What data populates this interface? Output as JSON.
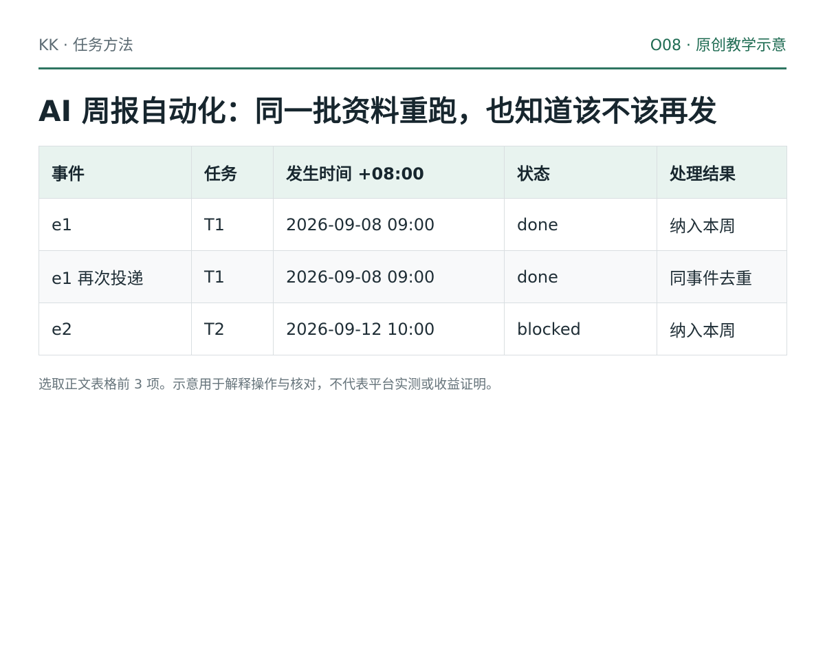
{
  "header": {
    "left_label": "KK · 任务方法",
    "right_label": "O08 · 原创教学示意"
  },
  "title": "AI 周报自动化：同一批资料重跑，也知道该不该再发",
  "table": {
    "columns": [
      "事件",
      "任务",
      "发生时间 +08:00",
      "状态",
      "处理结果"
    ],
    "rows": [
      [
        "e1",
        "T1",
        "2026-09-08 09:00",
        "done",
        "纳入本周"
      ],
      [
        "e1 再次投递",
        "T1",
        "2026-09-08 09:00",
        "done",
        "同事件去重"
      ],
      [
        "e2",
        "T2",
        "2026-09-12 10:00",
        "blocked",
        "纳入本周"
      ]
    ]
  },
  "footnote": "选取正文表格前 3 项。示意用于解释操作与核对，不代表平台实测或收益证明。",
  "colors": {
    "accent": "#2e7561",
    "header_bg": "#e8f3ef",
    "alt_row_bg": "#f8f9fa"
  }
}
